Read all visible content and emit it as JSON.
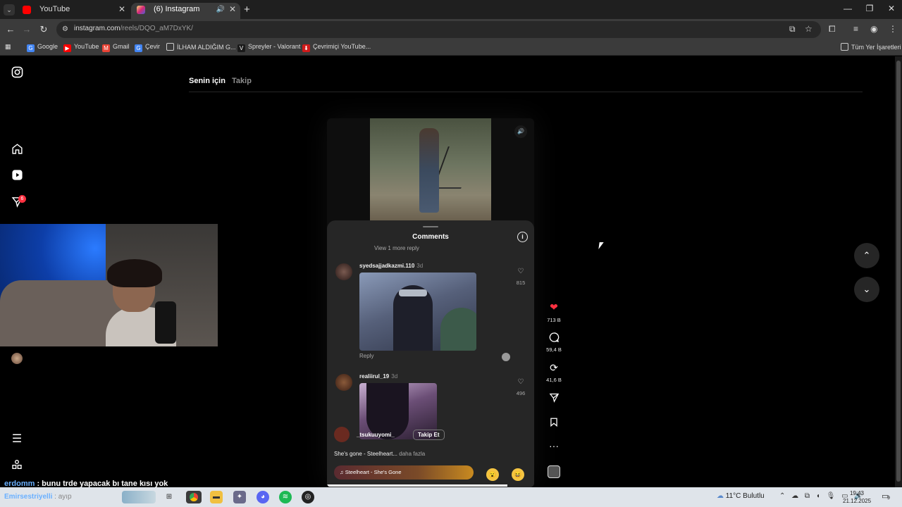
{
  "browser": {
    "tabs": [
      {
        "title": "YouTube",
        "favicon_color": "#ff0000",
        "active": false
      },
      {
        "title": "(6) Instagram",
        "favicon_color": "#d62976",
        "active": true
      }
    ],
    "url_domain": "instagram.com",
    "url_path": "/reels/DQO_aM7DxYK/",
    "bookmarks": [
      {
        "label": "Google",
        "icon": "google-icon",
        "color": "#4285f4",
        "glyph": "G"
      },
      {
        "label": "YouTube",
        "icon": "youtube-icon",
        "color": "#ff0000",
        "glyph": "▶"
      },
      {
        "label": "Gmail",
        "icon": "gmail-icon",
        "color": "#ea4335",
        "glyph": "M"
      },
      {
        "label": "Çevir",
        "icon": "translate-icon",
        "color": "#4285f4",
        "glyph": "G"
      },
      {
        "label": "İLHAM ALDIĞIM G...",
        "icon": "folder-icon",
        "color": "#3b3b3b",
        "glyph": "▭"
      },
      {
        "label": "Spreyler - Valorant",
        "icon": "valorant-icon",
        "color": "#1a1a1a",
        "glyph": "V"
      },
      {
        "label": "Çevrimiçi YouTube...",
        "icon": "converter-icon",
        "color": "#d11a1a",
        "glyph": "⬇"
      }
    ],
    "all_bookmarks_label": "Tüm Yer İşaretleri"
  },
  "instagram": {
    "feed_tabs": [
      "Senin için",
      "Takip"
    ],
    "notification_count": "6",
    "comments_title": "Comments",
    "view_more": "View 1 more reply",
    "comments": [
      {
        "user": "syedsajjadkazmi.110",
        "age": "3d",
        "likes": "815",
        "reply": "Reply"
      },
      {
        "user": "realiirul_19",
        "age": "3d",
        "likes": "496"
      }
    ],
    "author": "_tsukuuyomi_",
    "follow_label": "Takip Et",
    "caption": "She's gone - Steelheart...",
    "caption_more": "daha fazla",
    "music": "♫ Steelheart - She's Gone",
    "reactions": [
      "😮",
      "😆"
    ],
    "actions": {
      "likes": "713 B",
      "comments": "59,4 B",
      "reposts": "41,6 B"
    },
    "progress": 0.87
  },
  "chat": {
    "user": "erdomm",
    "message": " : bunu trde yapacak bı tane kısı yok"
  },
  "taskbar": {
    "ghost_user": "Emirsestriyelli",
    "ghost_text": ": ayıp",
    "weather": "11°C  Bulutlu",
    "time": "19:43",
    "date": "21.12.2025",
    "notifications": "9"
  }
}
